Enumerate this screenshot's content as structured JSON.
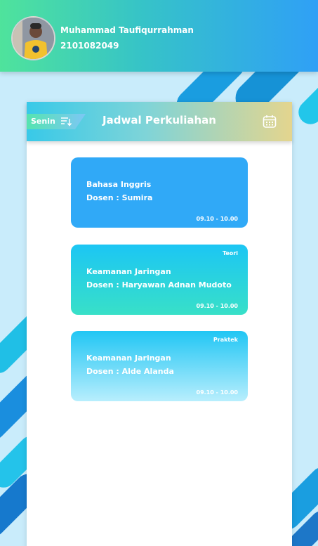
{
  "user": {
    "name": "Muhammad Taufiqurrahman",
    "id": "2101082049",
    "avatar_icon": "user-photo-icon"
  },
  "schedule": {
    "title": "Jadwal Perkuliahan",
    "day": "Senin",
    "sort_icon": "sort-icon",
    "calendar_icon": "calendar-icon"
  },
  "courses": [
    {
      "type": "",
      "course": "Bahasa Inggris",
      "lecturer": "Dosen : Sumira",
      "time": "09.10 - 10.00"
    },
    {
      "type": "Teori",
      "course": "Keamanan Jaringan",
      "lecturer": "Dosen : Haryawan Adnan Mudoto",
      "time": "09.10 - 10.00"
    },
    {
      "type": "Praktek",
      "course": "Keamanan Jaringan",
      "lecturer": "Dosen : Alde Alanda",
      "time": "09.10 - 10.00"
    }
  ],
  "colors": {
    "header_start": "#4fe39c",
    "header_end": "#2fa0f6",
    "card_blue": "#30a9f7",
    "card_teal": "#38e0c8",
    "background": "#c9ecfb"
  }
}
